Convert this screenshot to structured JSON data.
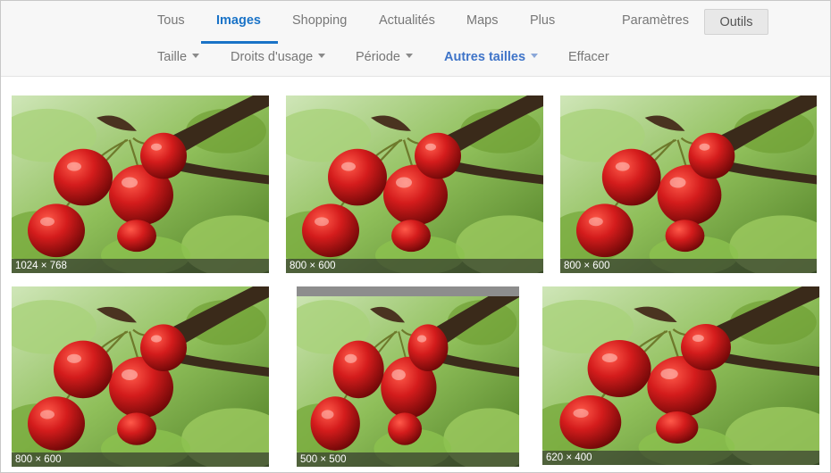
{
  "tabs": [
    {
      "label": "Tous"
    },
    {
      "label": "Images"
    },
    {
      "label": "Shopping"
    },
    {
      "label": "Actualités"
    },
    {
      "label": "Maps"
    },
    {
      "label": "Plus"
    },
    {
      "label": "Paramètres"
    }
  ],
  "active_tab": "Images",
  "tools_label": "Outils",
  "filters": [
    {
      "label": "Taille"
    },
    {
      "label": "Droits d'usage"
    },
    {
      "label": "Période"
    },
    {
      "label": "Autres tailles"
    },
    {
      "label": "Effacer"
    }
  ],
  "active_filter": "Autres tailles",
  "results": [
    {
      "size": "1024 × 768"
    },
    {
      "size": "800 × 600"
    },
    {
      "size": "800 × 600"
    },
    {
      "size": "800 × 600"
    },
    {
      "size": "500 × 500"
    },
    {
      "size": "620 × 400"
    }
  ],
  "colors": {
    "accent": "#1a73c7",
    "active_filter": "#3f74c8",
    "text": "#777777",
    "cherry": "#c4121a",
    "leaf": "#5f9d2c"
  }
}
